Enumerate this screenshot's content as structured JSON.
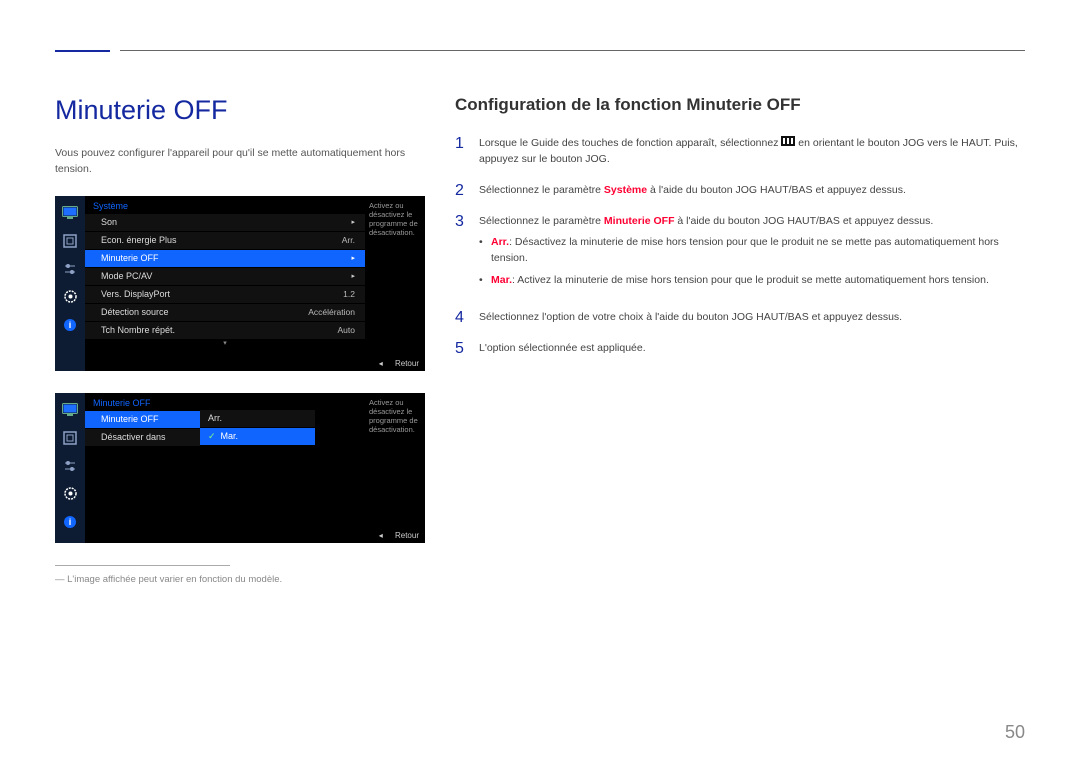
{
  "page_number": "50",
  "title": "Minuterie OFF",
  "intro": "Vous pouvez configurer l'appareil pour qu'il se mette automatiquement hors tension.",
  "subtitle": "Configuration de la fonction Minuterie OFF",
  "footnote": "L'image affichée peut varier en fonction du modèle.",
  "osd1": {
    "header": "Système",
    "desc": "Activez ou désactivez le programme de désactivation.",
    "rows": [
      {
        "label": "Son",
        "value": "",
        "chevron": true,
        "selected": false
      },
      {
        "label": "Econ. énergie Plus",
        "value": "Arr.",
        "chevron": false,
        "selected": false
      },
      {
        "label": "Minuterie OFF",
        "value": "",
        "chevron": true,
        "selected": true
      },
      {
        "label": "Mode PC/AV",
        "value": "",
        "chevron": true,
        "selected": false
      },
      {
        "label": "Vers. DisplayPort",
        "value": "1.2",
        "chevron": false,
        "selected": false
      },
      {
        "label": "Détection source",
        "value": "Accélération",
        "chevron": false,
        "selected": false
      },
      {
        "label": "Tch Nombre répét.",
        "value": "Auto",
        "chevron": false,
        "selected": false
      }
    ],
    "footer_label": "Retour"
  },
  "osd2": {
    "header": "Minuterie OFF",
    "desc": "Activez ou désactivez le programme de désactivation.",
    "submenu": [
      {
        "label": "Minuterie OFF",
        "selected": true
      },
      {
        "label": "Désactiver dans",
        "selected": false
      }
    ],
    "options": [
      {
        "label": "Arr.",
        "selected": false,
        "check": false
      },
      {
        "label": "Mar.",
        "selected": true,
        "check": true
      }
    ],
    "footer_label": "Retour"
  },
  "steps": {
    "s1_a": "Lorsque le Guide des touches de fonction apparaît, sélectionnez ",
    "s1_b": " en orientant le bouton JOG vers le HAUT. Puis, appuyez sur le bouton JOG.",
    "s2_a": "Sélectionnez le paramètre ",
    "s2_hl": "Système",
    "s2_b": " à l'aide du bouton JOG HAUT/BAS et appuyez dessus.",
    "s3_a": "Sélectionnez le paramètre ",
    "s3_hl": "Minuterie OFF",
    "s3_b": " à l'aide du bouton JOG HAUT/BAS et appuyez dessus.",
    "b1_label": "Arr.",
    "b1_text": ": Désactivez la minuterie de mise hors tension pour que le produit ne se mette pas automatiquement hors tension.",
    "b2_label": "Mar.",
    "b2_text": ": Activez la minuterie de mise hors tension pour que le produit se mette automatiquement hors tension.",
    "s4": "Sélectionnez l'option de votre choix à l'aide du bouton JOG HAUT/BAS et appuyez dessus.",
    "s5": "L'option sélectionnée est appliquée."
  }
}
